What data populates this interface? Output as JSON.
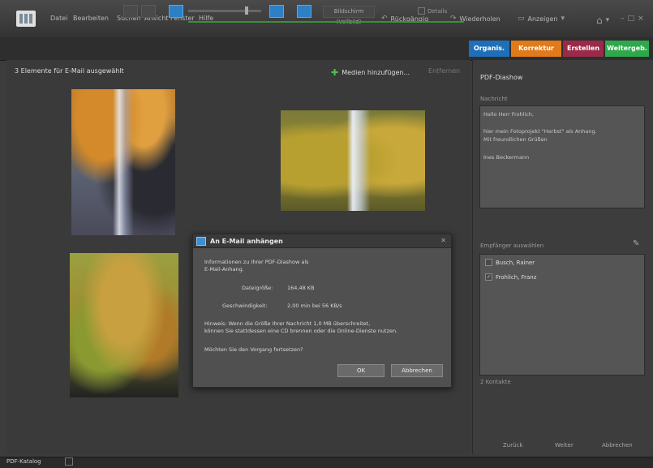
{
  "menu": [
    "Datei",
    "Bearbeiten",
    "Suchen",
    "Ansicht",
    "Fenster",
    "Hilfe"
  ],
  "toolbar_top": {
    "undo": "Rückgängig",
    "redo": "Wiederholen",
    "display": "Anzeigen",
    "home_icon": "home-icon"
  },
  "toolbar": {
    "fullscreen": "Bildschirm (Vollbild)",
    "details": "Details"
  },
  "mode_tabs": [
    {
      "label": "Organis.",
      "color": "#1f6fb8"
    },
    {
      "label": "Korrektur",
      "color": "#e07a1a"
    },
    {
      "label": "Erstellen",
      "color": "#9b2a4a"
    },
    {
      "label": "Weitergeb.",
      "color": "#2ea84a"
    }
  ],
  "main": {
    "selection_label": "3 Elemente für E-Mail ausgewählt",
    "add_media": "Medien hinzufügen...",
    "remove": "Entfernen"
  },
  "dialog": {
    "title": "An E-Mail anhängen",
    "intro1": "Informationen zu Ihrer PDF-Diashow als",
    "intro2": "E-Mail-Anhang.",
    "size_label": "Dateigröße:",
    "size_value": "164,48 KB",
    "time_label": "Geschwindigkeit:",
    "time_value": "2,00 min bei 56 KB/s",
    "warn1": "Hinweis: Wenn die Größe Ihrer Nachricht 1,0 MB überschreitet,",
    "warn2": "können Sie stattdessen eine CD brennen oder die Online-Dienste nutzen.",
    "question": "Möchten Sie den Vorgang fortsetzen?",
    "ok": "OK",
    "cancel": "Abbrechen"
  },
  "panel": {
    "title": "PDF-Diashow",
    "message_label": "Nachricht",
    "message_lines": [
      "Hallo Herr Frohlich,",
      "",
      "hier mein Fotoprojekt \"Herbst\" als Anhang.",
      "Mit freundlichen Grüßen",
      "",
      "Ines Beckermann"
    ],
    "recipients_label": "Empfänger auswählen",
    "recipients": [
      {
        "name": "Busch, Rainer",
        "checked": false
      },
      {
        "name": "Frohlich, Franz",
        "checked": true
      }
    ],
    "count": "2 Kontakte",
    "back": "Zurück",
    "next": "Weiter",
    "cancel": "Abbrechen"
  },
  "status": {
    "label": "PDF-Katalog"
  }
}
